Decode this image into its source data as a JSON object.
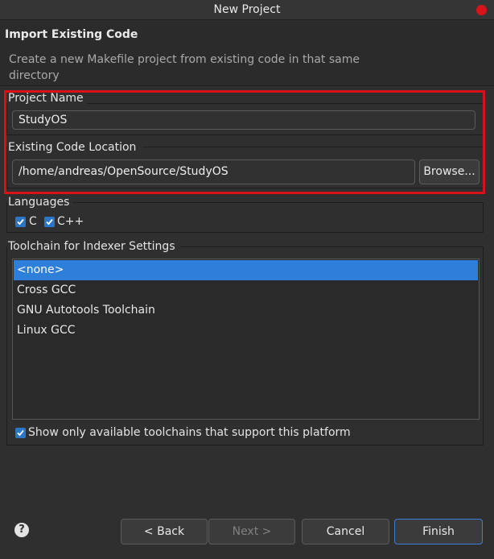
{
  "window": {
    "title": "New Project"
  },
  "header": {
    "title": "Import Existing Code",
    "description": "Create a new Makefile project from existing code in that same directory"
  },
  "project_name": {
    "label": "Project Name",
    "value": "StudyOS"
  },
  "code_location": {
    "label": "Existing Code Location",
    "value": "/home/andreas/OpenSource/StudyOS",
    "browse_label": "Browse..."
  },
  "languages": {
    "label": "Languages",
    "items": [
      {
        "label": "C",
        "checked": true
      },
      {
        "label": "C++",
        "checked": true
      }
    ]
  },
  "toolchain": {
    "label": "Toolchain for Indexer Settings",
    "items": [
      {
        "label": "<none>",
        "selected": true
      },
      {
        "label": "Cross GCC",
        "selected": false
      },
      {
        "label": "GNU Autotools Toolchain",
        "selected": false
      },
      {
        "label": "Linux GCC",
        "selected": false
      }
    ],
    "filter_label": "Show only available toolchains that support this platform",
    "filter_checked": true
  },
  "footer": {
    "help_symbol": "?",
    "back_label": "< Back",
    "next_label": "Next >",
    "cancel_label": "Cancel",
    "finish_label": "Finish"
  },
  "colors": {
    "accent": "#2e7fd9",
    "annotation_red": "#d9121a",
    "background": "#2f2f2f"
  },
  "icons": {
    "close": "close-icon",
    "checkbox": "check-icon",
    "help": "help-icon"
  }
}
